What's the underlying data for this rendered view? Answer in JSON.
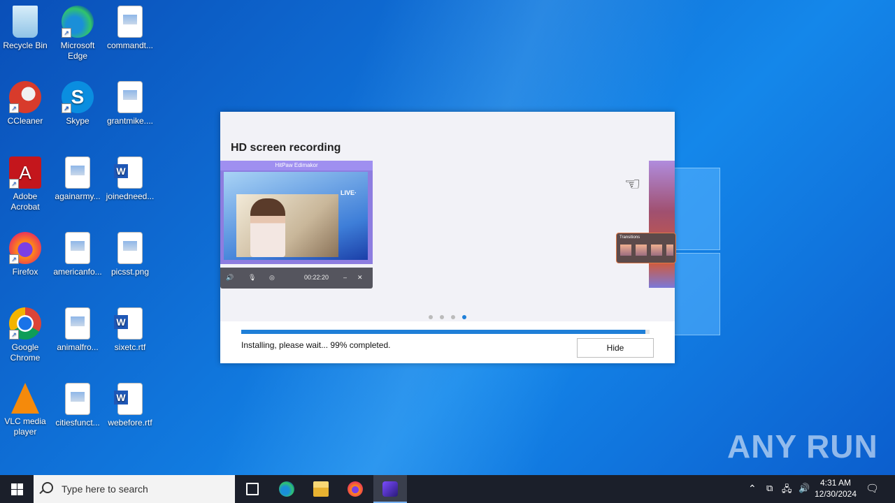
{
  "desktop": {
    "icons": [
      {
        "label": "Recycle Bin"
      },
      {
        "label": "Microsoft Edge"
      },
      {
        "label": "commandt..."
      },
      {
        "label": "CCleaner"
      },
      {
        "label": "Skype"
      },
      {
        "label": "grantmike...."
      },
      {
        "label": "Adobe Acrobat"
      },
      {
        "label": "againarmy..."
      },
      {
        "label": "joinedneed..."
      },
      {
        "label": "Firefox"
      },
      {
        "label": "americanfo..."
      },
      {
        "label": "picsst.png"
      },
      {
        "label": "Google Chrome"
      },
      {
        "label": "animalfro..."
      },
      {
        "label": "sixetc.rtf"
      },
      {
        "label": "VLC media player"
      },
      {
        "label": "citiesfunct..."
      },
      {
        "label": "webefore.rtf"
      }
    ]
  },
  "installer": {
    "slide_title": "HD screen recording",
    "preview_app_title": "HitPaw Edimakor",
    "preview_live": "LIVE·",
    "preview_timer": "00:22:20",
    "transitions_label": "Transitions",
    "progress_percent": 99,
    "status_text": "Installing, please wait... 99% completed.",
    "hide_label": "Hide",
    "active_dot": 3
  },
  "watermark": "ANY RUN",
  "taskbar": {
    "search_placeholder": "Type here to search",
    "time": "4:31 AM",
    "date": "12/30/2024"
  },
  "colors": {
    "accent": "#1f7fd8",
    "taskbar": "#1b1f2a",
    "desktop": "#0f6fd6"
  }
}
